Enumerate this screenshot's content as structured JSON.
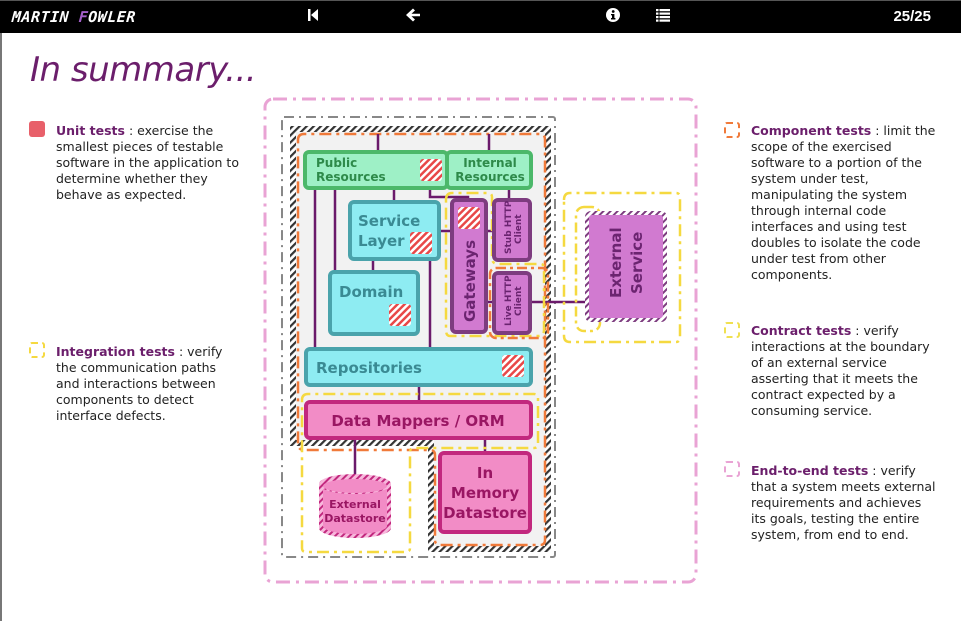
{
  "topbar": {
    "brand_first": "MARTIN ",
    "brand_accent": "F",
    "brand_rest": "OWLER",
    "first_slide_icon": "skip-to-start-icon",
    "back_icon": "arrow-left-icon",
    "info_icon": "info-circle-icon",
    "toc_icon": "list-icon",
    "page_counter": "25/25"
  },
  "slide": {
    "title": "In summary..."
  },
  "legend": {
    "unit": {
      "name": "Unit tests",
      "text": " : exercise the smallest pieces of testable software in the application to determine whether they behave as expected.",
      "color": "#e8606a"
    },
    "integration": {
      "name": "Integration tests",
      "text": " : verify the communication paths and interactions between components to detect interface defects.",
      "color": "#f5d940"
    },
    "component": {
      "name": "Component tests",
      "text": " : limit the scope of the exercised software to a portion of the system under test, manipulating the system through internal code interfaces and using test doubles to isolate the code under test from other components.",
      "color": "#f07a3a"
    },
    "contract": {
      "name": "Contract tests",
      "text": " : verify interactions at the boundary of an external service asserting that it meets the contract expected by a consuming service.",
      "color": "#f0e050"
    },
    "e2e": {
      "name": "End-to-end tests",
      "text": " : verify that a system meets external requirements and achieves its goals, testing the entire system, from end to end.",
      "color": "#e9a3d4"
    }
  },
  "diagram": {
    "nodes": {
      "public_resources": [
        "Public",
        "Resources"
      ],
      "internal_resources": [
        "Internal",
        "Resources"
      ],
      "service_layer": [
        "Service",
        "Layer"
      ],
      "domain": "Domain",
      "gateways": "Gateways",
      "stub_http_client": [
        "Stub HTTP",
        "Client"
      ],
      "live_http_client": [
        "Live HTTP",
        "Client"
      ],
      "external_service": [
        "External",
        "Service"
      ],
      "repositories": "Repositories",
      "data_mappers": "Data Mappers / ORM",
      "external_datastore": [
        "External",
        "Datastore"
      ],
      "in_memory_datastore": [
        "In",
        "Memory",
        "Datastore"
      ]
    },
    "colors": {
      "green_fill": "#9ef0c6",
      "green_stroke": "#4cb86a",
      "green_text": "#2e8a4a",
      "cyan_fill": "#8eecf2",
      "cyan_stroke": "#4aa3ab",
      "cyan_text": "#3a8a93",
      "purple_fill": "#d17ad0",
      "purple_stroke": "#7d3c7f",
      "purple_text": "#6b2470",
      "pink_fill": "#f28cc6",
      "pink_stroke": "#c2287e",
      "pink_text": "#9a1663",
      "connector": "#6b1a6b",
      "unit_marker": "#e84848"
    }
  }
}
